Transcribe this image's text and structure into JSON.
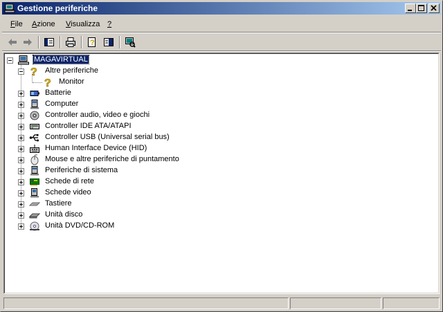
{
  "window": {
    "title": "Gestione periferiche",
    "icon": "device-manager-icon",
    "controls": [
      "minimize-icon",
      "maximize-icon",
      "close-icon"
    ]
  },
  "menu": {
    "items": [
      {
        "label": "File",
        "accel": "F",
        "rest": "ile"
      },
      {
        "label": "Azione",
        "accel": "A",
        "rest": "zione"
      },
      {
        "label": "Visualizza",
        "accel": "V",
        "rest": "isualizza"
      },
      {
        "label": "?",
        "accel": "?",
        "rest": ""
      }
    ]
  },
  "toolbar": {
    "buttons": [
      "back-arrow-icon",
      "forward-arrow-icon",
      "show-hide-tree-icon",
      "print-icon",
      "properties-icon",
      "help-icon",
      "scan-hardware-icon"
    ]
  },
  "tree": {
    "root": {
      "label": "MAGAVIRTUAL",
      "icon": "computer-icon"
    },
    "open_category": {
      "label": "Altre periferiche",
      "icon": "unknown-device-icon",
      "children": [
        {
          "label": "Monitor",
          "icon": "unknown-device-icon"
        }
      ]
    },
    "categories": [
      {
        "label": "Batterie",
        "icon": "battery-icon"
      },
      {
        "label": "Computer",
        "icon": "computer-icon"
      },
      {
        "label": "Controller audio, video e giochi",
        "icon": "speaker-icon"
      },
      {
        "label": "Controller IDE ATA/ATAPI",
        "icon": "ide-controller-icon"
      },
      {
        "label": "Controller USB (Universal serial bus)",
        "icon": "usb-icon"
      },
      {
        "label": "Human Interface Device (HID)",
        "icon": "hid-icon"
      },
      {
        "label": "Mouse e altre periferiche di puntamento",
        "icon": "mouse-icon"
      },
      {
        "label": "Periferiche di sistema",
        "icon": "system-device-icon"
      },
      {
        "label": "Schede di rete",
        "icon": "network-card-icon"
      },
      {
        "label": "Schede video",
        "icon": "display-adapter-icon"
      },
      {
        "label": "Tastiere",
        "icon": "keyboard-icon"
      },
      {
        "label": "Unità disco",
        "icon": "disk-drive-icon"
      },
      {
        "label": "Unità DVD/CD-ROM",
        "icon": "cdrom-icon"
      }
    ]
  },
  "statusbar": {
    "panels": [
      "",
      "",
      ""
    ]
  }
}
